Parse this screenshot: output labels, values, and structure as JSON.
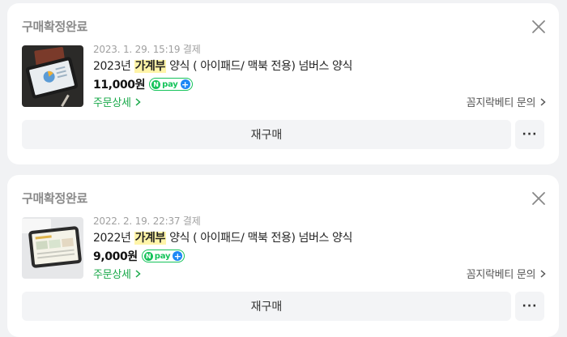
{
  "orders": [
    {
      "status": "구매확정완료",
      "date": "2023. 1. 29. 15:19 결제",
      "title_before": "2023년 ",
      "title_highlight": "가계부",
      "title_after": " 양식 ( 아이패드/ 맥북 전용) 넘버스 양식",
      "price": "11,000원",
      "detail_link": "주문상세",
      "seller_link": "꼼지락베티 문의",
      "rebuy_label": "재구매",
      "more_label": "···",
      "npay": {
        "n": "N",
        "pay": "pay",
        "plus": "+"
      },
      "thumb_icon": "ipad-budget-dark-thumbnail"
    },
    {
      "status": "구매확정완료",
      "date": "2022. 2. 19. 22:37 결제",
      "title_before": "2022년 ",
      "title_highlight": "가계부",
      "title_after": " 양식 ( 아이패드/ 맥북 전용) 넘버스 양식",
      "price": "9,000원",
      "detail_link": "주문상세",
      "seller_link": "꼼지락베티 문의",
      "rebuy_label": "재구매",
      "more_label": "···",
      "npay": {
        "n": "N",
        "pay": "pay",
        "plus": "+"
      },
      "thumb_icon": "ipad-budget-light-thumbnail"
    }
  ],
  "colors": {
    "page_bg": "#f1f2f4",
    "accent_green": "#17a848",
    "npay_green": "#15c35a",
    "npay_blue": "#1e88f5",
    "highlight": "#fff4a8"
  }
}
